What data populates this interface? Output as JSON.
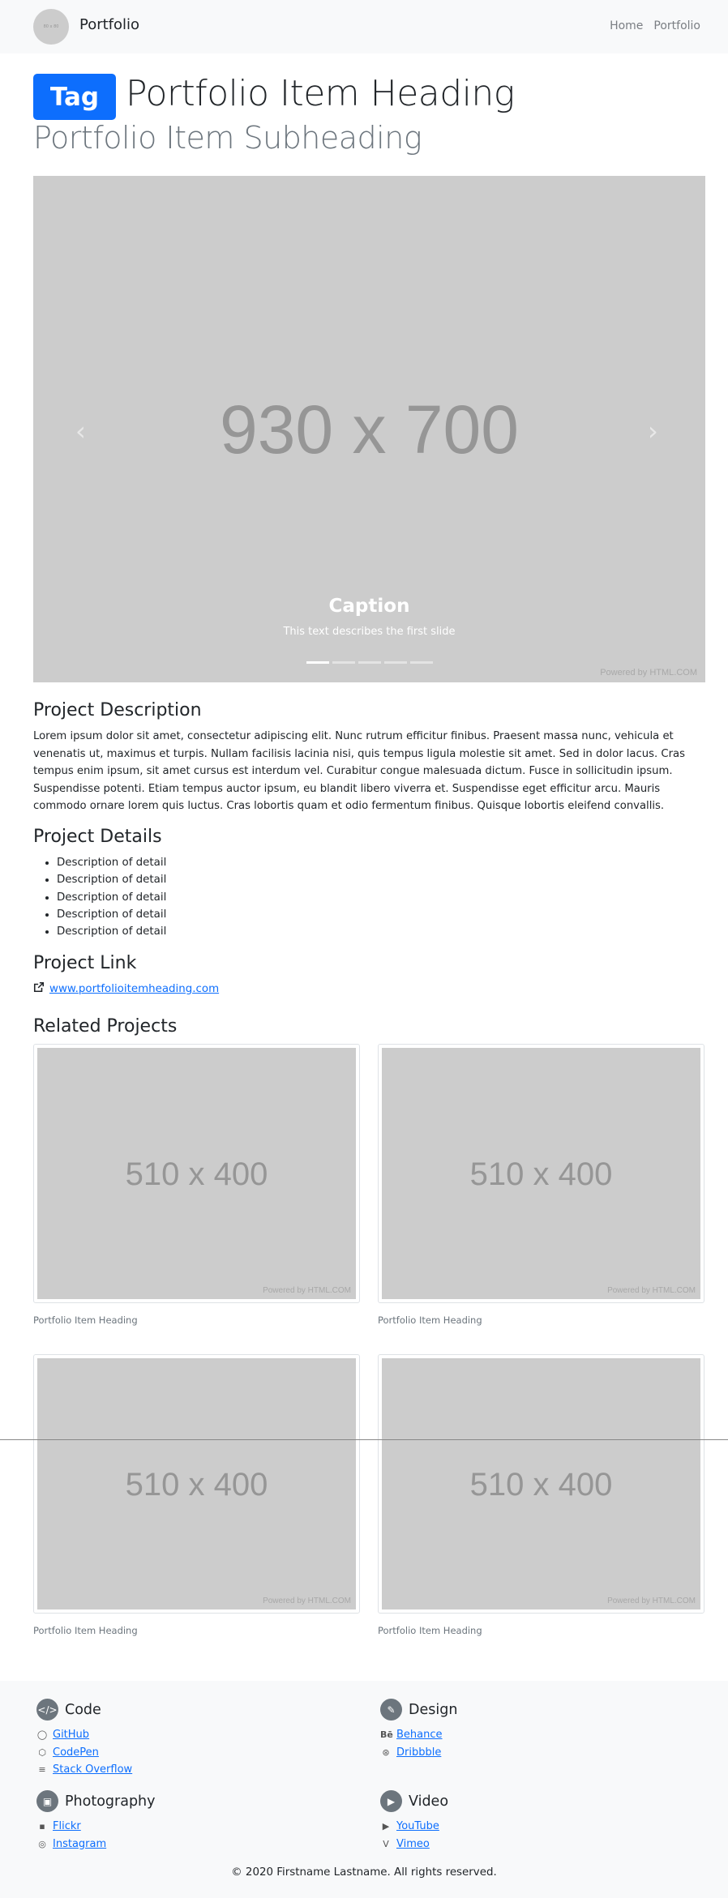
{
  "navbar": {
    "logo_text": "80 x 80",
    "brand": "Portfolio",
    "links": [
      "Home",
      "Portfolio"
    ]
  },
  "header": {
    "tag": "Tag",
    "heading": "Portfolio Item Heading",
    "subheading": "Portfolio Item Subheading"
  },
  "carousel": {
    "image_size": "930 x 700",
    "caption_title": "Caption",
    "caption_text": "This text describes the first slide",
    "powered_by": "Powered by HTML.COM",
    "prev": "‹",
    "next": "›",
    "indicator_count": 5,
    "active_index": 0
  },
  "description": {
    "title": "Project Description",
    "text": "Lorem ipsum dolor sit amet, consectetur adipiscing elit. Nunc rutrum efficitur finibus. Praesent massa nunc, vehicula et venenatis ut, maximus et turpis. Nullam facilisis lacinia nisi, quis tempus ligula molestie sit amet. Sed in dolor lacus. Cras tempus enim ipsum, sit amet cursus est interdum vel. Curabitur congue malesuada dictum. Fusce in sollicitudin ipsum. Suspendisse potenti. Etiam tempus auctor ipsum, eu blandit libero viverra et. Suspendisse eget efficitur arcu. Mauris commodo ornare lorem quis luctus. Cras lobortis quam et odio fermentum finibus. Quisque lobortis eleifend convallis."
  },
  "details": {
    "title": "Project Details",
    "items": [
      "Description of detail",
      "Description of detail",
      "Description of detail",
      "Description of detail",
      "Description of detail"
    ]
  },
  "project_link": {
    "title": "Project Link",
    "url_text": "www.portfolioitemheading.com"
  },
  "related": {
    "title": "Related Projects",
    "items": [
      {
        "size": "510 x 400",
        "powered": "Powered by HTML.COM",
        "caption": "Portfolio Item Heading"
      },
      {
        "size": "510 x 400",
        "powered": "Powered by HTML.COM",
        "caption": "Portfolio Item Heading"
      },
      {
        "size": "510 x 400",
        "powered": "Powered by HTML.COM",
        "caption": "Portfolio Item Heading"
      },
      {
        "size": "510 x 400",
        "powered": "Powered by HTML.COM",
        "caption": "Portfolio Item Heading"
      }
    ]
  },
  "footer": {
    "code": {
      "title": "Code",
      "icon": "code-icon",
      "links": [
        "GitHub",
        "CodePen",
        "Stack Overflow"
      ]
    },
    "design": {
      "title": "Design",
      "icon": "brush-icon",
      "links": [
        "Behance",
        "Dribbble"
      ]
    },
    "photography": {
      "title": "Photography",
      "icon": "images-icon",
      "links": [
        "Flickr",
        "Instagram"
      ]
    },
    "video": {
      "title": "Video",
      "icon": "video-camera-icon",
      "links": [
        "YouTube",
        "Vimeo"
      ]
    },
    "copyright": "© 2020 Firstname Lastname. All rights reserved."
  },
  "colors": {
    "primary": "#0d6efd",
    "placeholder": "#cccccc",
    "muted": "#6c757d",
    "light": "#f8f9fa"
  }
}
